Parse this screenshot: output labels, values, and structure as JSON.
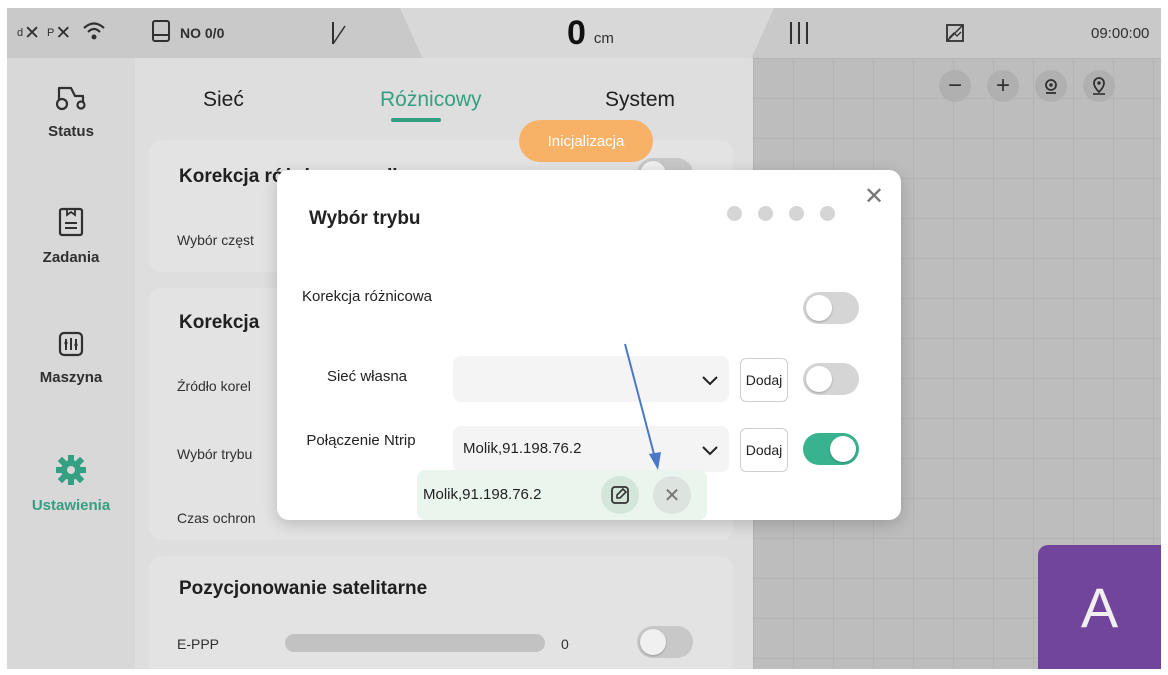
{
  "status_bar": {
    "signal_d": "d",
    "signal_p": "P",
    "job_label": "NO 0/0",
    "distance_value": "0",
    "distance_unit": "cm",
    "clock": "09:00:00"
  },
  "sidebar": {
    "items": [
      {
        "label": "Status",
        "icon": "tractor-icon",
        "active": false
      },
      {
        "label": "Zadania",
        "icon": "clipboard-icon",
        "active": false
      },
      {
        "label": "Maszyna",
        "icon": "machine-settings-icon",
        "active": false
      },
      {
        "label": "Ustawienia",
        "icon": "gear-icon",
        "active": true
      }
    ]
  },
  "tabs": [
    {
      "label": "Sieć",
      "active": false
    },
    {
      "label": "Różnicowy",
      "active": true
    },
    {
      "label": "System",
      "active": false
    }
  ],
  "background_settings": {
    "card1_title": "Korekcja różnicowa radla",
    "card1_row": "Wybór częst",
    "card2_title": "Korekcja",
    "card2_rows": [
      "Źródło korel",
      "Wybór trybu",
      "Czas ochron"
    ],
    "card3_title": "Pozycjonowanie satelitarne",
    "card3_row": "E-PPP",
    "card3_value": "0"
  },
  "init_badge": "Inicjalizacja",
  "map": {
    "controls": [
      "zoom-out-icon",
      "zoom-in-icon",
      "locate-icon",
      "location-pin-icon"
    ],
    "auto_button": "A"
  },
  "dialog": {
    "title": "Wybór trybu",
    "rows": [
      {
        "label": "Korekcja różnicowa",
        "toggle_on": false
      },
      {
        "label": "Sieć własna",
        "select_value": "",
        "add_label": "Dodaj",
        "toggle_on": false
      },
      {
        "label": "Połączenie Ntrip",
        "select_value": "Molik,91.198.76.2",
        "add_label": "Dodaj",
        "toggle_on": true
      }
    ],
    "saved_entry": "Molik,91.198.76.2"
  },
  "colors": {
    "accent": "#39a98a",
    "toggle_on": "#39b38f",
    "badge": "#f7b267",
    "auto_button": "#7a4aa6",
    "annotation_arrow": "#4a78c8"
  }
}
